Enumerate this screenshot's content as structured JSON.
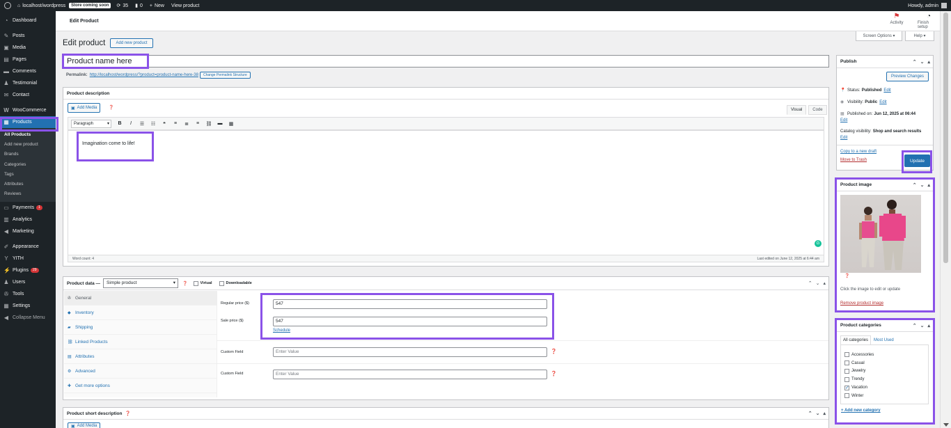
{
  "adminbar": {
    "site": "localhost/wordpress",
    "store_badge": "Store coming soon",
    "updates_count": "35",
    "comments_count": "0",
    "new_label": "New",
    "view_product": "View product",
    "howdy": "Howdy, admin"
  },
  "sidebar": {
    "items": [
      {
        "label": "Dashboard",
        "icon": "dashboard-icon"
      },
      {
        "label": "Posts",
        "icon": "pin-icon"
      },
      {
        "label": "Media",
        "icon": "media-icon"
      },
      {
        "label": "Pages",
        "icon": "page-icon"
      },
      {
        "label": "Comments",
        "icon": "comment-icon"
      },
      {
        "label": "Testimonial",
        "icon": "person-icon"
      },
      {
        "label": "Contact",
        "icon": "mail-icon"
      },
      {
        "label": "WooCommerce",
        "icon": "woo-icon"
      },
      {
        "label": "Products",
        "icon": "archive-icon"
      }
    ],
    "submenu": [
      "All Products",
      "Add new product",
      "Brands",
      "Categories",
      "Tags",
      "Attributes",
      "Reviews"
    ],
    "items2": [
      {
        "label": "Payments",
        "badge": "1"
      },
      {
        "label": "Analytics"
      },
      {
        "label": "Marketing"
      },
      {
        "label": "Appearance"
      },
      {
        "label": "YITH"
      },
      {
        "label": "Plugins",
        "badge": "29"
      },
      {
        "label": "Users"
      },
      {
        "label": "Tools"
      },
      {
        "label": "Settings"
      },
      {
        "label": "Collapse Menu"
      }
    ]
  },
  "header": {
    "crumb": "Edit Product",
    "activity": "Activity",
    "finish_setup": "Finish setup",
    "screen_options": "Screen Options ▾",
    "help": "Help ▾"
  },
  "main": {
    "title": "Edit product",
    "add_new": "Add new product",
    "product_name": "Product name here",
    "permalink_label": "Permalink:",
    "permalink_url": "http://localhost/wordpress/?product=product-name-here-38",
    "change_permalink": "Change Permalink Structure"
  },
  "description": {
    "title": "Product description",
    "add_media": "Add Media",
    "tab_visual": "Visual",
    "tab_code": "Code",
    "paragraph": "Paragraph",
    "content": "Imagination come to life!",
    "word_count": "Word count: 4",
    "last_edited": "Last edited on June 12, 2025 at 6:44 am"
  },
  "product_data": {
    "title": "Product data —",
    "type": "Simple product",
    "virtual": "Virtual",
    "downloadable": "Downloadable",
    "tabs": [
      "General",
      "Inventory",
      "Shipping",
      "Linked Products",
      "Attributes",
      "Advanced",
      "Get more options"
    ],
    "regular_price_label": "Regular price ($)",
    "regular_price": "547",
    "sale_price_label": "Sale price ($)",
    "sale_price": "547",
    "schedule": "Schedule",
    "custom_field_label": "Custom Field",
    "custom_placeholder": "Enter Value"
  },
  "short_description": {
    "title": "Product short description",
    "add_media": "Add Media"
  },
  "publish": {
    "title": "Publish",
    "preview": "Preview Changes",
    "status_label": "Status:",
    "status": "Published",
    "visibility_label": "Visibility:",
    "visibility": "Public",
    "published_label": "Published on:",
    "published_on": "Jun 12, 2025 at 06:44",
    "catalog_label": "Catalog visibility:",
    "catalog": "Shop and search results",
    "edit": "Edit",
    "copy_draft": "Copy to a new draft",
    "trash": "Move to Trash",
    "update": "Update"
  },
  "product_image": {
    "title": "Product image",
    "hint": "Click the image to edit or update",
    "remove": "Remove product image"
  },
  "categories": {
    "title": "Product categories",
    "tab_all": "All categories",
    "tab_used": "Most Used",
    "items": [
      {
        "name": "Accessories",
        "checked": false
      },
      {
        "name": "Casual",
        "checked": false
      },
      {
        "name": "Jewelry",
        "checked": false
      },
      {
        "name": "Trendy",
        "checked": false
      },
      {
        "name": "Vacation",
        "checked": true
      },
      {
        "name": "Winter",
        "checked": false
      }
    ],
    "add_new": "+ Add new category"
  },
  "colors": {
    "accent": "#2271b1",
    "highlight": "#8a52e8",
    "admin_dark": "#1d2327"
  }
}
